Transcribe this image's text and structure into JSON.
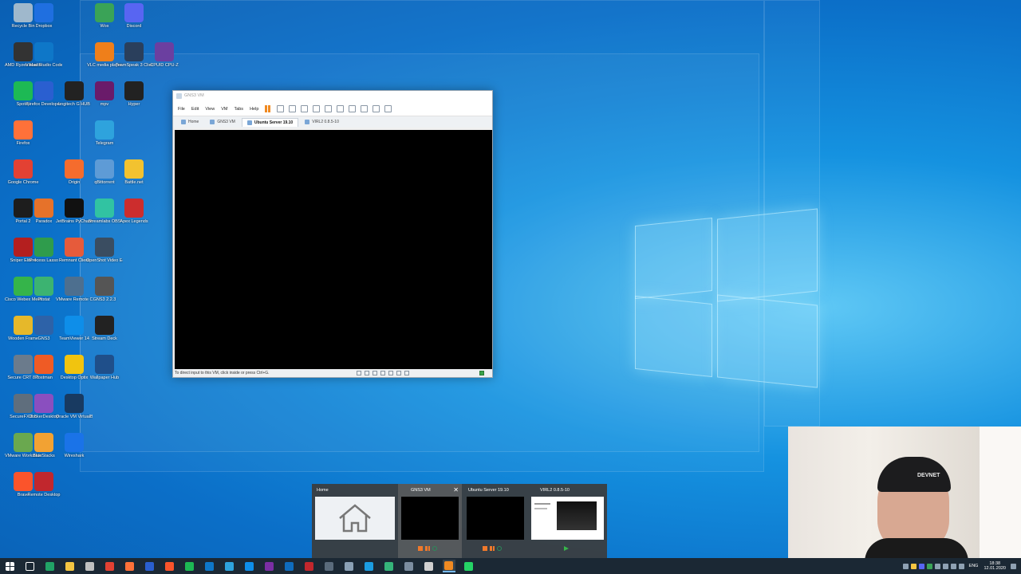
{
  "desktop": {
    "icons": [
      {
        "label": "Recycle Bin",
        "color": "#9fb8cc"
      },
      {
        "label": "Dropbox",
        "color": "#1f6fe0"
      },
      {
        "label": "Wox",
        "color": "#3aa357"
      },
      {
        "label": "Discord",
        "color": "#5865f2"
      },
      {
        "label": "AMD Ryzen Master",
        "color": "#333333"
      },
      {
        "label": "Visual Studio Code",
        "color": "#0e77c8"
      },
      {
        "label": "VLC media player",
        "color": "#ef7f1a"
      },
      {
        "label": "TeamSpeak 3 Client",
        "color": "#2a3f5c"
      },
      {
        "label": "CPUID CPU-Z",
        "color": "#6b3fa0"
      },
      {
        "label": "Spotify",
        "color": "#1db954"
      },
      {
        "label": "Firefox Developer",
        "color": "#2a5fd0"
      },
      {
        "label": "Logitech G HUB",
        "color": "#222222"
      },
      {
        "label": "mpv",
        "color": "#6a1b6a"
      },
      {
        "label": "Hyper",
        "color": "#222222"
      },
      {
        "label": "Firefox",
        "color": "#ff7139"
      },
      {
        "label": "Telegram",
        "color": "#2ea3dd"
      },
      {
        "label": "Google Chrome",
        "color": "#e34133"
      },
      {
        "label": "Origin",
        "color": "#f56c2d"
      },
      {
        "label": "qBittorrent",
        "color": "#5e9bd6"
      },
      {
        "label": "Battle.net",
        "color": "#f2c230"
      },
      {
        "label": "Portal 2",
        "color": "#1d1d1d"
      },
      {
        "label": "Paradox",
        "color": "#e6722a"
      },
      {
        "label": "JetBrains PyCharm",
        "color": "#111111"
      },
      {
        "label": "Streamlabs OBS",
        "color": "#31c3a2"
      },
      {
        "label": "Apex Legends",
        "color": "#cc2d2d"
      },
      {
        "label": "Sniper Elite 4",
        "color": "#b41f1f"
      },
      {
        "label": "Process Lasso",
        "color": "#2f9c4c"
      },
      {
        "label": "Remnant Client",
        "color": "#e65b3b"
      },
      {
        "label": "OpenShot Video Editor",
        "color": "#3a4d61"
      },
      {
        "label": "Cisco Webex Meetings",
        "color": "#35b44a"
      },
      {
        "label": "Pitstat",
        "color": "#3cb371"
      },
      {
        "label": "VMware Remote Console",
        "color": "#4d6f8f"
      },
      {
        "label": "GNS3 2.2.3",
        "color": "#555555"
      },
      {
        "label": "Wooden Frame",
        "color": "#e6b82a"
      },
      {
        "label": "GNS3",
        "color": "#2d62a8"
      },
      {
        "label": "TeamViewer 14",
        "color": "#0e8ee9"
      },
      {
        "label": "Stream Deck",
        "color": "#222222"
      },
      {
        "label": "Secure CRT 8.5",
        "color": "#6b7b8c"
      },
      {
        "label": "Postman",
        "color": "#ef5b25"
      },
      {
        "label": "Desktop Optix",
        "color": "#f1c40f"
      },
      {
        "label": "Wallpaper Hub",
        "color": "#1f4f8a"
      },
      {
        "label": "SecureFX 8.5",
        "color": "#5f6e7d"
      },
      {
        "label": "DockerDesktop",
        "color": "#8a4fbf"
      },
      {
        "label": "Oracle VM VirtualBox",
        "color": "#183a61"
      },
      {
        "label": "VMware Workstation",
        "color": "#6aa84f"
      },
      {
        "label": "BlueStacks",
        "color": "#f2a233"
      },
      {
        "label": "Wireshark",
        "color": "#1a73e8"
      },
      {
        "label": "Brave",
        "color": "#fb542b"
      },
      {
        "label": "Remote Desktop",
        "color": "#c1272d"
      }
    ]
  },
  "vm_window": {
    "title": "GNS3 VM",
    "menu": [
      "File",
      "Edit",
      "View",
      "VM",
      "Tabs",
      "Help"
    ],
    "tabs": [
      {
        "label": "Home",
        "active": false
      },
      {
        "label": "GNS3 VM",
        "active": false
      },
      {
        "label": "Ubuntu Server 19.10",
        "active": true
      },
      {
        "label": "VIRL2 0.8.5-10",
        "active": false
      }
    ],
    "status_text": "To direct input to this VM, click inside or press Ctrl+G."
  },
  "thumbnails": [
    {
      "title": "Home"
    },
    {
      "title": "GNS3 VM"
    },
    {
      "title": "Ubuntu Server 19.10"
    },
    {
      "title": "VIRL2 0.8.5-10"
    }
  ],
  "webcam": {
    "cap_text": "DEVNET"
  },
  "taskbar": {
    "icons": [
      {
        "name": "start-icon",
        "color": "#ffffff"
      },
      {
        "name": "task-view-icon",
        "color": "#ffffff"
      },
      {
        "name": "excel-like-icon",
        "color": "#21a366"
      },
      {
        "name": "folder-icon",
        "color": "#f4c542"
      },
      {
        "name": "settings-icon",
        "color": "#c0c0c0"
      },
      {
        "name": "chrome-icon",
        "color": "#e34133"
      },
      {
        "name": "firefox-icon",
        "color": "#ff7139"
      },
      {
        "name": "firefox-dev-icon",
        "color": "#2a5fd0"
      },
      {
        "name": "brave-icon",
        "color": "#fb542b"
      },
      {
        "name": "spotify-icon",
        "color": "#1db954"
      },
      {
        "name": "vscode-icon",
        "color": "#0e77c8"
      },
      {
        "name": "telegram-icon",
        "color": "#2ea3dd"
      },
      {
        "name": "teamviewer-icon",
        "color": "#0e8ee9"
      },
      {
        "name": "onenote-icon",
        "color": "#7b2ea3"
      },
      {
        "name": "outlook-icon",
        "color": "#0f6cbd"
      },
      {
        "name": "remote-desktop-icon",
        "color": "#c1272d"
      },
      {
        "name": "calculator-icon",
        "color": "#5a6b7c"
      },
      {
        "name": "app-icon",
        "color": "#8aa0b5"
      },
      {
        "name": "edge-icon",
        "color": "#1b9de2"
      },
      {
        "name": "gns3-icon",
        "color": "#35b47a"
      },
      {
        "name": "monitor-icon",
        "color": "#7b8da0"
      },
      {
        "name": "unity-icon",
        "color": "#d0d0d0"
      },
      {
        "name": "vmware-icon",
        "color": "#f08a22"
      },
      {
        "name": "whatsapp-icon",
        "color": "#25d366"
      }
    ]
  },
  "tray": {
    "lang": "ENG",
    "time": "18:38",
    "date": "12.01.2020"
  }
}
